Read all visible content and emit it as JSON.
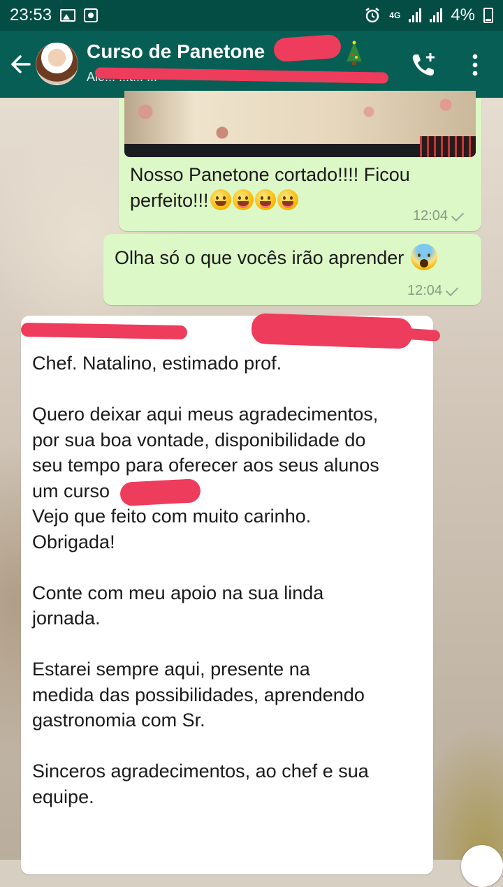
{
  "status_bar": {
    "time": "23:53",
    "network": "4G",
    "battery": "4%"
  },
  "header": {
    "title": "Curso de Panetone",
    "subtitle": "Ale... ...t... ...",
    "back_icon": "arrow-left-icon",
    "tree_icon": "christmas-tree-icon",
    "call_icon": "add-call-icon",
    "menu_icon": "more-vertical-icon"
  },
  "messages": [
    {
      "direction": "outgoing",
      "has_photo": true,
      "lines": [
        "Nosso Panetone cortado!!!! Ficou",
        "perfeito!!!"
      ],
      "emojis": [
        "grinning-face",
        "face-savoring-food",
        "face-savoring-food",
        "face-savoring-food"
      ],
      "time": "12:04"
    },
    {
      "direction": "outgoing",
      "text": "Olha só  o que vocês irão aprender",
      "emojis": [
        "face-screaming-in-fear"
      ],
      "time": "12:04"
    },
    {
      "direction": "incoming",
      "text": "Chef. Natalino, estimado prof.\n\nQuero deixar aqui meus agradecimentos,\npor sua boa vontade, disponibilidade do\nseu tempo para oferecer aos seus alunos\num curso\nVejo que feito com muito carinho.\nObrigada!\n\nConte com meu apoio na sua linda\njornada.\n\nEstarei sempre aqui, presente na\nmedida das possibilidades, aprendendo\ngastronomia com  Sr.\n\nSinceros agradecimentos, ao chef e sua\nequipe."
    }
  ],
  "colors": {
    "status_bar": "#044d45",
    "app_bar": "#075e54",
    "outgoing_bubble": "#dcf8c6",
    "incoming_bubble": "#ffffff",
    "redaction": "#ee3c5c"
  }
}
